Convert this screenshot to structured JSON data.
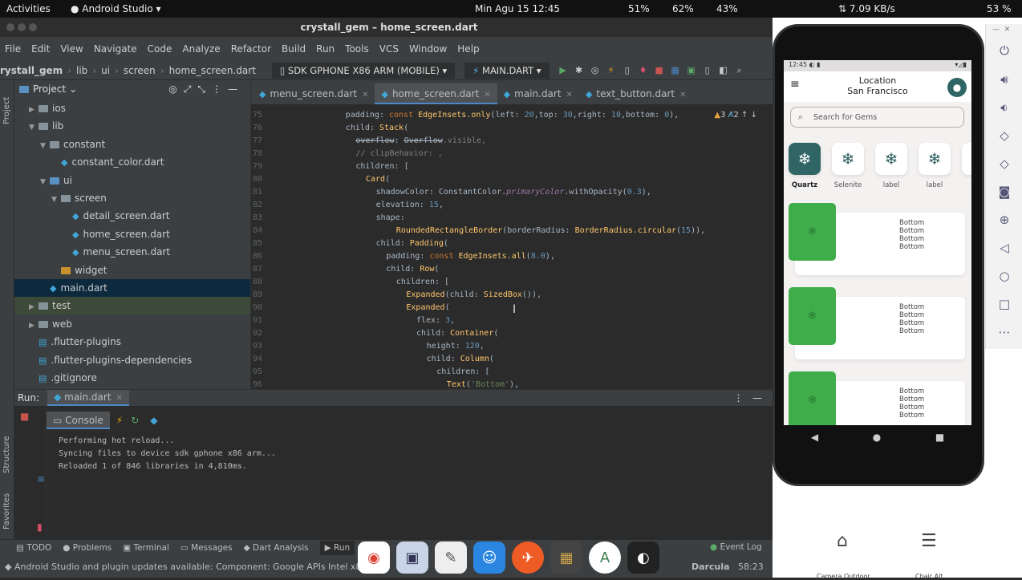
{
  "topbar": {
    "activities": "Activities",
    "app": "Android Studio ▾",
    "datetime": "Min Agu 15  12:45",
    "cpu": "51%",
    "ram": "62%",
    "swap": "43%",
    "net": "⇅ 7.09 KB/s",
    "battery": "53 %"
  },
  "window": {
    "title": "crystall_gem – home_screen.dart"
  },
  "menu": [
    "File",
    "Edit",
    "View",
    "Navigate",
    "Code",
    "Analyze",
    "Refactor",
    "Build",
    "Run",
    "Tools",
    "VCS",
    "Window",
    "Help"
  ],
  "breadcrumb": [
    "rystall_gem",
    "lib",
    "ui",
    "screen",
    "home_screen.dart"
  ],
  "toolbar": {
    "device": "SDK GPHONE X86 ARM (MOBILE)",
    "config": "MAIN.DART"
  },
  "project": {
    "title": "Project",
    "items": [
      {
        "label": "ios",
        "type": "folder",
        "level": 1,
        "arrow": "▶"
      },
      {
        "label": "lib",
        "type": "folder",
        "level": 1,
        "arrow": "▼"
      },
      {
        "label": "constant",
        "type": "folder",
        "level": 2,
        "arrow": "▼"
      },
      {
        "label": "constant_color.dart",
        "type": "dart",
        "level": 3
      },
      {
        "label": "ui",
        "type": "folder-blue",
        "level": 2,
        "arrow": "▼"
      },
      {
        "label": "screen",
        "type": "folder",
        "level": 3,
        "arrow": "▼"
      },
      {
        "label": "detail_screen.dart",
        "type": "dart",
        "level": 4
      },
      {
        "label": "home_screen.dart",
        "type": "dart",
        "level": 4
      },
      {
        "label": "menu_screen.dart",
        "type": "dart",
        "level": 4
      },
      {
        "label": "widget",
        "type": "folder-orange",
        "level": 3
      },
      {
        "label": "main.dart",
        "type": "dart",
        "level": 2,
        "selected": true
      },
      {
        "label": "test",
        "type": "folder",
        "level": 1,
        "arrow": "▶",
        "highlight": true
      },
      {
        "label": "web",
        "type": "folder",
        "level": 1,
        "arrow": "▶"
      },
      {
        "label": ".flutter-plugins",
        "type": "file",
        "level": 1
      },
      {
        "label": ".flutter-plugins-dependencies",
        "type": "file",
        "level": 1
      },
      {
        "label": ".gitignore",
        "type": "file",
        "level": 1
      }
    ]
  },
  "tabs": [
    {
      "label": "menu_screen.dart"
    },
    {
      "label": "home_screen.dart",
      "active": true
    },
    {
      "label": "main.dart"
    },
    {
      "label": "text_button.dart"
    }
  ],
  "inspections": {
    "warnings": "3",
    "typos": "2"
  },
  "code": [
    {
      "n": "75",
      "indent": 6,
      "t": [
        [
          "p",
          "padding: "
        ],
        [
          "k",
          "const "
        ],
        [
          "c",
          "EdgeInsets.only"
        ],
        [
          "p",
          "(left: "
        ],
        [
          "n",
          "20"
        ],
        [
          "p",
          ",top: "
        ],
        [
          "n",
          "30"
        ],
        [
          "p",
          ",right: "
        ],
        [
          "n",
          "10"
        ],
        [
          "p",
          ",bottom: "
        ],
        [
          "n",
          "0"
        ],
        [
          "p",
          "),"
        ]
      ]
    },
    {
      "n": "76",
      "indent": 6,
      "t": [
        [
          "p",
          "child: "
        ],
        [
          "c",
          "Stack"
        ],
        [
          "p",
          "("
        ]
      ]
    },
    {
      "n": "77",
      "indent": 8,
      "t": [
        [
          "st",
          "overflow"
        ],
        [
          "p",
          ": "
        ],
        [
          "st",
          "Overflow"
        ],
        [
          "cm",
          ".visible,"
        ]
      ]
    },
    {
      "n": "78",
      "indent": 8,
      "t": [
        [
          "cm",
          "// clipBehavior: ,"
        ]
      ]
    },
    {
      "n": "79",
      "indent": 8,
      "t": [
        [
          "p",
          "children: ["
        ]
      ]
    },
    {
      "n": "80",
      "indent": 10,
      "t": [
        [
          "c",
          "Card"
        ],
        [
          "p",
          "("
        ]
      ]
    },
    {
      "n": "81",
      "indent": 12,
      "t": [
        [
          "p",
          "shadowColor: ConstantColor."
        ],
        [
          "i",
          "primaryColor"
        ],
        [
          "p",
          ".withOpacity("
        ],
        [
          "n",
          "0.3"
        ],
        [
          "p",
          "),"
        ]
      ]
    },
    {
      "n": "82",
      "indent": 12,
      "t": [
        [
          "p",
          "elevation: "
        ],
        [
          "n",
          "15"
        ],
        [
          "p",
          ","
        ]
      ]
    },
    {
      "n": "83",
      "indent": 12,
      "t": [
        [
          "p",
          "shape:"
        ]
      ]
    },
    {
      "n": "84",
      "indent": 16,
      "t": [
        [
          "c",
          "RoundedRectangleBorder"
        ],
        [
          "p",
          "(borderRadius: "
        ],
        [
          "c",
          "BorderRadius.circular"
        ],
        [
          "p",
          "("
        ],
        [
          "n",
          "15"
        ],
        [
          "p",
          ")),"
        ]
      ]
    },
    {
      "n": "85",
      "indent": 12,
      "t": [
        [
          "p",
          "child: "
        ],
        [
          "c",
          "Padding"
        ],
        [
          "p",
          "("
        ]
      ]
    },
    {
      "n": "86",
      "indent": 14,
      "t": [
        [
          "p",
          "padding: "
        ],
        [
          "k",
          "const "
        ],
        [
          "c",
          "EdgeInsets.all"
        ],
        [
          "p",
          "("
        ],
        [
          "n",
          "8.0"
        ],
        [
          "p",
          "),"
        ]
      ]
    },
    {
      "n": "87",
      "indent": 14,
      "t": [
        [
          "p",
          "child: "
        ],
        [
          "c",
          "Row"
        ],
        [
          "p",
          "("
        ]
      ]
    },
    {
      "n": "88",
      "indent": 16,
      "t": [
        [
          "p",
          "children: ["
        ]
      ]
    },
    {
      "n": "89",
      "indent": 18,
      "t": [
        [
          "c",
          "Expanded"
        ],
        [
          "p",
          "(child: "
        ],
        [
          "c",
          "SizedBox"
        ],
        [
          "p",
          "()),"
        ]
      ]
    },
    {
      "n": "90",
      "indent": 18,
      "t": [
        [
          "c",
          "Expanded"
        ],
        [
          "p",
          "("
        ]
      ]
    },
    {
      "n": "91",
      "indent": 20,
      "t": [
        [
          "p",
          "flex: "
        ],
        [
          "n",
          "3"
        ],
        [
          "p",
          ","
        ]
      ]
    },
    {
      "n": "92",
      "indent": 20,
      "t": [
        [
          "p",
          "child: "
        ],
        [
          "c",
          "Container"
        ],
        [
          "p",
          "("
        ]
      ]
    },
    {
      "n": "93",
      "indent": 22,
      "t": [
        [
          "p",
          "height: "
        ],
        [
          "n",
          "120"
        ],
        [
          "p",
          ","
        ]
      ]
    },
    {
      "n": "94",
      "indent": 22,
      "t": [
        [
          "p",
          "child: "
        ],
        [
          "c",
          "Column"
        ],
        [
          "p",
          "("
        ]
      ]
    },
    {
      "n": "95",
      "indent": 24,
      "t": [
        [
          "p",
          "children: ["
        ]
      ]
    },
    {
      "n": "96",
      "indent": 26,
      "t": [
        [
          "c",
          "Text"
        ],
        [
          "p",
          "("
        ],
        [
          "s",
          "'Bottom'"
        ],
        [
          "p",
          "),"
        ]
      ]
    }
  ],
  "run": {
    "label": "Run:",
    "config": "main.dart",
    "console_tab": "Console",
    "output": [
      "Performing hot reload...",
      "Syncing files to device sdk gphone x86 arm...",
      "Reloaded 1 of 846 libraries in 4,810ms."
    ]
  },
  "bottom_tabs": [
    "TODO",
    "Problems",
    "Terminal",
    "Messages",
    "Dart Analysis",
    "Run"
  ],
  "event_log": "Event Log",
  "status": {
    "message": "Android Studio and plugin updates available: Component: Google APIs Intel x86 ...",
    "theme": "Darcula",
    "position": "58:23"
  },
  "side_tools": {
    "project": "Project",
    "structure": "Structure",
    "favorites": "Favorites"
  },
  "phone": {
    "time": "12:45",
    "location_label": "Location",
    "location": "San Francisco",
    "search_placeholder": "Search for Gems",
    "categories": [
      "Quartz",
      "Selenite",
      "label",
      "label"
    ],
    "cards": [
      [
        "Bottom",
        "Bottom",
        "Bottom",
        "Bottom"
      ],
      [
        "Bottom",
        "Bottom",
        "Bottom",
        "Bottom"
      ],
      [
        "Bottom",
        "Bottom",
        "Bottom",
        "Bottom"
      ]
    ],
    "primary_color": "#2f6565"
  },
  "bg_app": {
    "items": [
      "Camera Outdoor",
      "Chair Alt"
    ]
  }
}
